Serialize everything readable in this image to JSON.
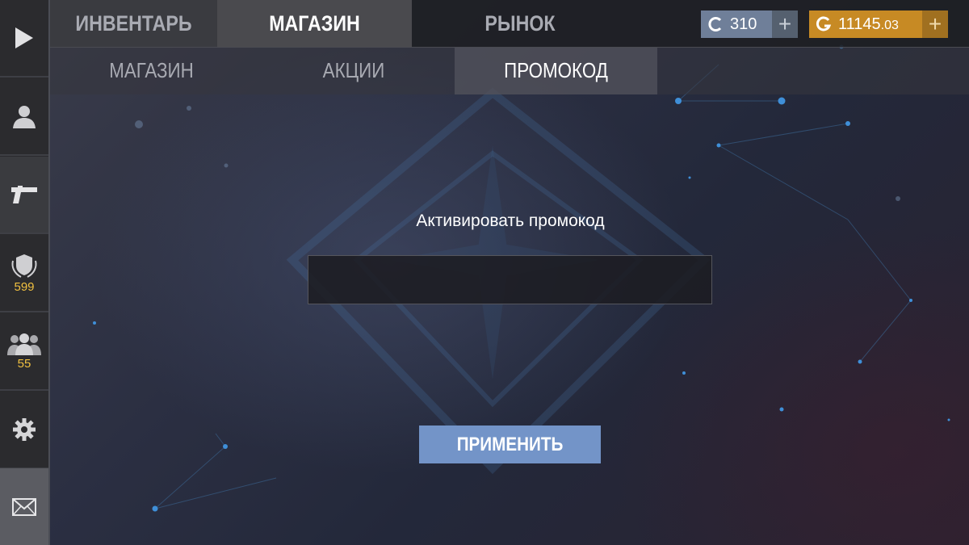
{
  "top_tabs": [
    {
      "label": "ИНВЕНТАРЬ",
      "active": false
    },
    {
      "label": "МАГАЗИН",
      "active": true
    },
    {
      "label": "РЫНОК",
      "active": false
    }
  ],
  "sub_tabs": [
    {
      "label": "МАГАЗИН",
      "active": false
    },
    {
      "label": "АКЦИИ",
      "active": false
    },
    {
      "label": "ПРОМОКОД",
      "active": true
    }
  ],
  "currency": {
    "silver": {
      "value": "310",
      "icon": "silver-coin-icon",
      "color": "#7d90ad"
    },
    "gold": {
      "value_main": "11145",
      "value_decimal": ".03",
      "icon": "gold-coin-icon",
      "color": "#d79a2a"
    },
    "plus_label": "+"
  },
  "sidebar": {
    "items": [
      {
        "icon": "play-icon"
      },
      {
        "icon": "profile-icon"
      },
      {
        "icon": "pistol-icon"
      },
      {
        "icon": "rank-shield-icon",
        "count": "599"
      },
      {
        "icon": "friends-icon",
        "count": "55"
      },
      {
        "icon": "gear-icon"
      },
      {
        "icon": "mail-icon"
      }
    ]
  },
  "promo": {
    "title": "Активировать промокод",
    "input_value": "",
    "apply_label": "ПРИМЕНИТЬ"
  },
  "colors": {
    "accent_button": "#7394c8",
    "count_text": "#f0c040",
    "active_tab_text": "#ffffff",
    "inactive_tab_text": "#a9abb3"
  }
}
